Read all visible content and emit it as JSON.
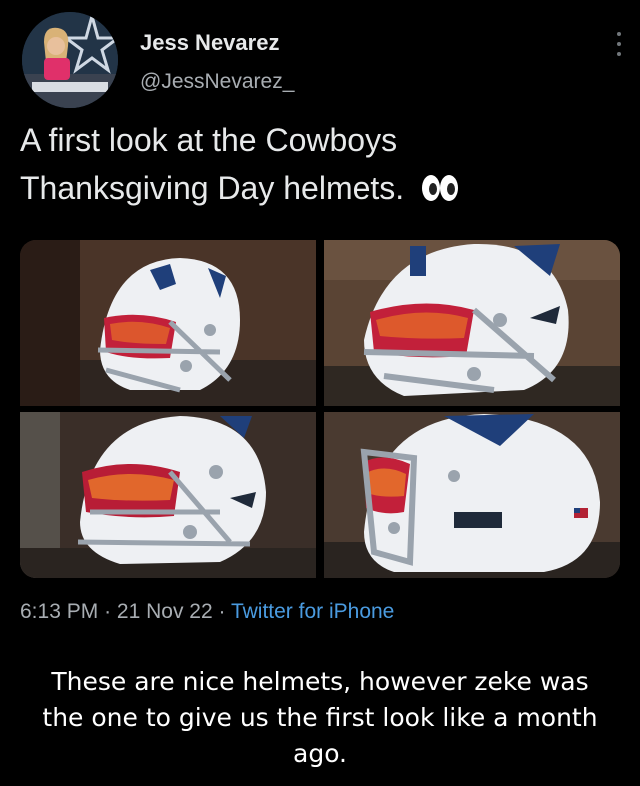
{
  "tweet": {
    "author_name": "Jess Nevarez",
    "handle": "@JessNevarez_",
    "text_line1": "A first look at the Cowboys",
    "text_line2": "Thanksgiving Day helmets.",
    "emoji": "eyes-emoji",
    "time": "6:13 PM",
    "date": "21 Nov 22",
    "separator": "·",
    "source": "Twitter for iPhone"
  },
  "photos": [
    {
      "icon": "helmet-photo",
      "visor": "red-orange"
    },
    {
      "icon": "helmet-photo",
      "visor": "red-orange"
    },
    {
      "icon": "helmet-photo",
      "visor": "red-orange"
    },
    {
      "icon": "helmet-photo",
      "visor": "red-orange"
    }
  ],
  "comment": {
    "line1": "These are nice helmets, however zeke was",
    "line2": "the one to give us the first look like a month",
    "line3": "ago."
  },
  "colors": {
    "background": "#000000",
    "text": "#e7e9ea",
    "muted": "#a8adb2",
    "link": "#4a9be0",
    "star": "#1f3f7a"
  }
}
